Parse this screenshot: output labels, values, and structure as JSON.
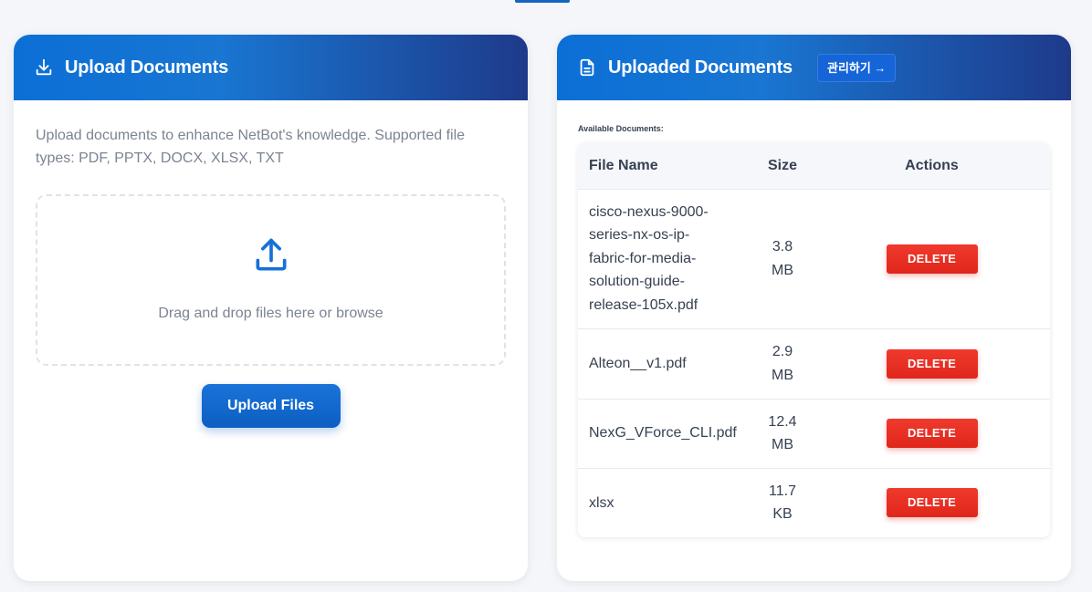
{
  "upload_card": {
    "title": "Upload Documents",
    "header_icon": "download-icon",
    "description": "Upload documents to enhance NetBot's knowledge. Supported file types: PDF, PPTX, DOCX, XLSX, TXT",
    "dropzone_icon": "upload-icon",
    "dropzone_text": "Drag and drop files here or browse",
    "upload_button": "Upload Files"
  },
  "documents_card": {
    "title": "Uploaded Documents",
    "header_icon": "document-icon",
    "manage_button": "관리하기 →",
    "available_label": "Available Documents:",
    "columns": [
      "File Name",
      "Size",
      "Actions"
    ],
    "rows": [
      {
        "name": "cisco-nexus-9000-series-nx-os-ip-fabric-for-media-solution-guide-release-105x.pdf",
        "size": "3.8 MB",
        "action": "DELETE"
      },
      {
        "name": "Alteon__v1.pdf",
        "size": "2.9 MB",
        "action": "DELETE"
      },
      {
        "name": "NexG_VForce_CLI.pdf",
        "size": "12.4 MB",
        "action": "DELETE"
      },
      {
        "name": "xlsx",
        "size": "11.7 KB",
        "action": "DELETE"
      }
    ]
  },
  "colors": {
    "header_gradient_start": "#0b6fd6",
    "header_gradient_end": "#1e3a8a",
    "primary_blue": "#1565c0",
    "delete_red": "#e53226"
  }
}
